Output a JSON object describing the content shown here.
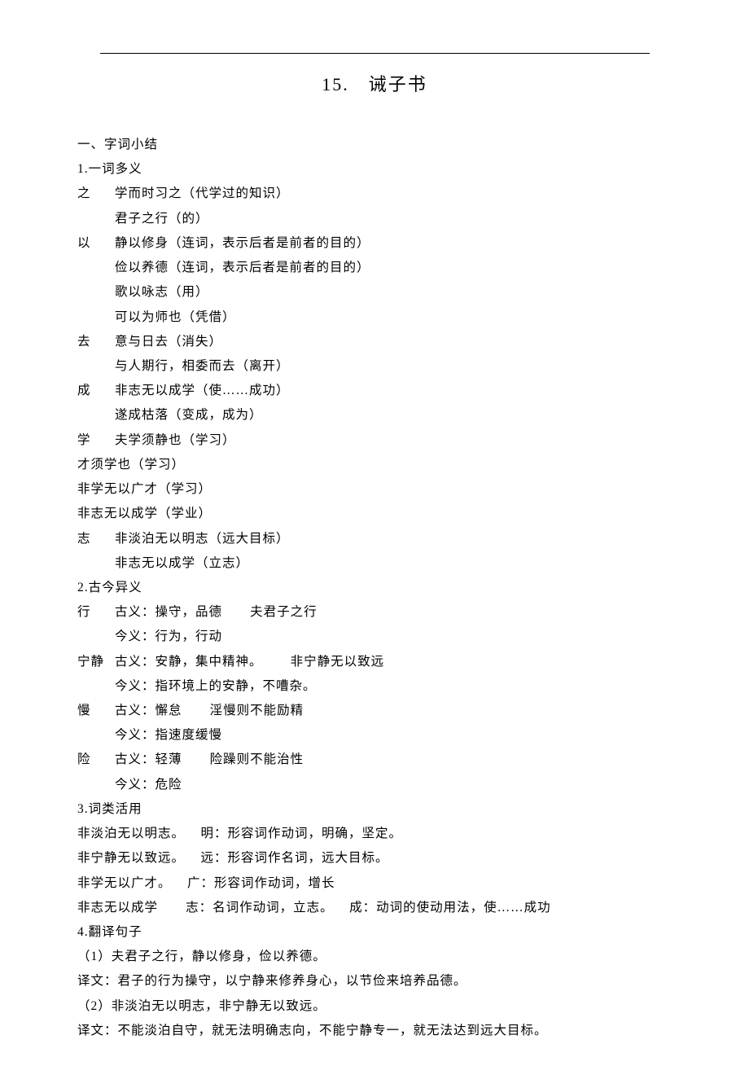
{
  "title": {
    "number": "15.",
    "name": "诫子书"
  },
  "sections": {
    "s1_header": "一、字词小结",
    "s1_1_header": "1.一词多义",
    "zhi": {
      "head": "之",
      "l1": "学而时习之（代学过的知识）",
      "l2": "君子之行（的）"
    },
    "yi": {
      "head": "以",
      "l1": "静以修身（连词，表示后者是前者的目的）",
      "l2": "俭以养德（连词，表示后者是前者的目的）",
      "l3": "歌以咏志（用）",
      "l4": "可以为师也（凭借）"
    },
    "qu": {
      "head": "去",
      "l1": "意与日去（消失）",
      "l2": "与人期行，相委而去（离开）"
    },
    "cheng": {
      "head": "成",
      "l1": "非志无以成学（使……成功）",
      "l2": "遂成枯落（变成，成为）"
    },
    "xue": {
      "head": "学",
      "l1": "夫学须静也（学习）",
      "l2": "才须学也（学习）",
      "l3": "非学无以广才（学习）",
      "l4": "非志无以成学（学业）"
    },
    "zhi2": {
      "head": "志",
      "l1": "非淡泊无以明志（远大目标）",
      "l2": "非志无以成学（立志）"
    },
    "s1_2_header": "2.古今异义",
    "xing": {
      "head": "行",
      "l1": "古义：操守，品德       夫君子之行",
      "l2": "今义：行为，行动"
    },
    "ningjing": {
      "head": "宁静",
      "l1": "古义：安静，集中精神。       非宁静无以致远",
      "l2": "今义：指环境上的安静，不嘈杂。"
    },
    "man": {
      "head": "慢",
      "l1": "古义：懈怠       淫慢则不能励精",
      "l2": "今义：指速度缓慢"
    },
    "xian": {
      "head": "险",
      "l1": "古义：轻薄       险躁则不能治性",
      "l2": "今义：危险"
    },
    "s1_3_header": "3.词类活用",
    "wl1": "非淡泊无以明志。    明：形容词作动词，明确，坚定。",
    "wl2": "非宁静无以致远。    远：形容词作名词，远大目标。",
    "wl3": "非学无以广才。    广：形容词作动词，增长",
    "wl4": "非志无以成学       志：名词作动词，立志。    成：动词的使动用法，使……成功",
    "s1_4_header": "4.翻译句子",
    "t1_src": "（1）夫君子之行，静以修身，俭以养德。",
    "t1_trans": "译文：君子的行为操守，以宁静来修养身心，以节俭来培养品德。",
    "t2_src": "（2）非淡泊无以明志，非宁静无以致远。",
    "t2_trans": "译文：不能淡泊自守，就无法明确志向，不能宁静专一，就无法达到远大目标。"
  }
}
